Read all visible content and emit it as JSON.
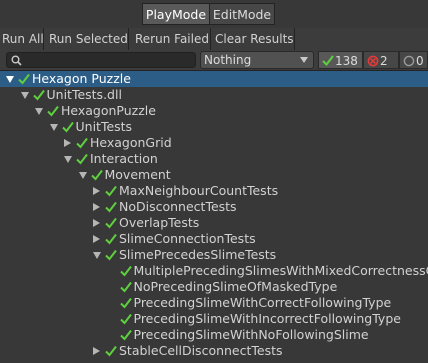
{
  "tabs": [
    {
      "label": "PlayMode",
      "active": true
    },
    {
      "label": "EditMode",
      "active": false
    }
  ],
  "toolbar": {
    "run_all": "Run All",
    "run_selected": "Run Selected",
    "rerun_failed": "Rerun Failed",
    "clear_results": "Clear Results"
  },
  "filter": {
    "search_value": "",
    "category_selected": "Nothing",
    "passed_count": "138",
    "failed_count": "2",
    "notrun_count": "0"
  },
  "colors": {
    "pass": "#5ecf3f",
    "fail": "#e03a3a",
    "selected": "#2c5d87"
  },
  "tree": [
    {
      "label": "Hexagon Puzzle",
      "depth": 0,
      "expander": "open",
      "selected": true
    },
    {
      "label": "UnitTests.dll",
      "depth": 1,
      "expander": "open"
    },
    {
      "label": "HexagonPuzzle",
      "depth": 2,
      "expander": "open"
    },
    {
      "label": "UnitTests",
      "depth": 3,
      "expander": "open"
    },
    {
      "label": "HexagonGrid",
      "depth": 4,
      "expander": "closed"
    },
    {
      "label": "Interaction",
      "depth": 4,
      "expander": "open"
    },
    {
      "label": "Movement",
      "depth": 5,
      "expander": "open"
    },
    {
      "label": "MaxNeighbourCountTests",
      "depth": 6,
      "expander": "closed"
    },
    {
      "label": "NoDisconnectTests",
      "depth": 6,
      "expander": "closed"
    },
    {
      "label": "OverlapTests",
      "depth": 6,
      "expander": "closed"
    },
    {
      "label": "SlimeConnectionTests",
      "depth": 6,
      "expander": "closed"
    },
    {
      "label": "SlimePrecedesSlimeTests",
      "depth": 6,
      "expander": "open"
    },
    {
      "label": "MultiplePrecedingSlimesWithMixedCorrectnessOfFollowingType",
      "depth": 7,
      "expander": "none"
    },
    {
      "label": "NoPrecedingSlimeOfMaskedType",
      "depth": 7,
      "expander": "none"
    },
    {
      "label": "PrecedingSlimeWithCorrectFollowingType",
      "depth": 7,
      "expander": "none"
    },
    {
      "label": "PrecedingSlimeWithIncorrectFollowingType",
      "depth": 7,
      "expander": "none"
    },
    {
      "label": "PrecedingSlimeWithNoFollowingSlime",
      "depth": 7,
      "expander": "none"
    },
    {
      "label": "StableCellDisconnectTests",
      "depth": 6,
      "expander": "closed"
    }
  ]
}
